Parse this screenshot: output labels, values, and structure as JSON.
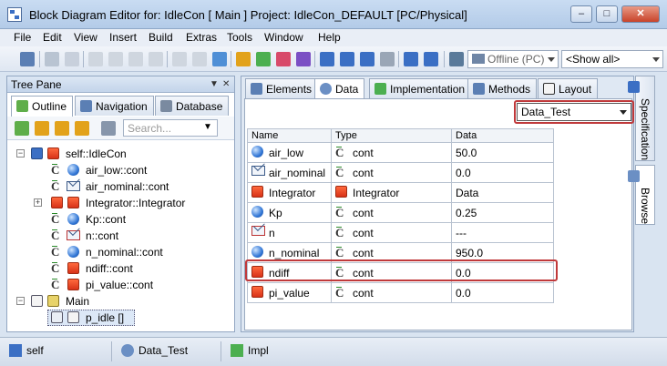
{
  "window": {
    "title": "Block Diagram Editor for: IdleCon [ Main ] Project: IdleCon_DEFAULT [PC/Physical]",
    "minimize_glyph": "–",
    "maximize_glyph": "□",
    "close_glyph": "✕"
  },
  "menu": [
    "File",
    "Edit",
    "View",
    "Insert",
    "Build",
    "Extras",
    "Tools",
    "Window",
    "Help"
  ],
  "toolbar": {
    "mode_value": "Offline (PC)",
    "show_value": "<Show all>"
  },
  "tree_pane": {
    "title": "Tree Pane",
    "tabs": [
      "Outline",
      "Navigation",
      "Database"
    ],
    "search_placeholder": "Search...",
    "nodes": [
      {
        "label": "self::IdleCon"
      },
      {
        "label": "air_low::cont"
      },
      {
        "label": "air_nominal::cont"
      },
      {
        "label": "Integrator::Integrator"
      },
      {
        "label": "Kp::cont"
      },
      {
        "label": "n::cont"
      },
      {
        "label": "n_nominal::cont"
      },
      {
        "label": "ndiff::cont"
      },
      {
        "label": "pi_value::cont"
      },
      {
        "label": "Main"
      },
      {
        "label": "p_idle []"
      }
    ]
  },
  "editor": {
    "tabs": [
      "Elements",
      "Data",
      "Implementation",
      "Methods",
      "Layout"
    ],
    "active_tab": "Data",
    "dataset_value": "Data_Test",
    "columns": [
      "Name",
      "Type",
      "Data"
    ],
    "rows": [
      {
        "name": "air_low",
        "type": "cont",
        "data": "50.0"
      },
      {
        "name": "air_nominal",
        "type": "cont",
        "data": "0.0"
      },
      {
        "name": "Integrator",
        "type": "Integrator",
        "data": "Data"
      },
      {
        "name": "Kp",
        "type": "cont",
        "data": "0.25"
      },
      {
        "name": "n",
        "type": "cont",
        "data": "---"
      },
      {
        "name": "n_nominal",
        "type": "cont",
        "data": "950.0"
      },
      {
        "name": "ndiff",
        "type": "cont",
        "data": "0.0"
      },
      {
        "name": "pi_value",
        "type": "cont",
        "data": "0.0"
      }
    ]
  },
  "side_tabs": [
    "Specification",
    "Browse"
  ],
  "status": {
    "item1": "self",
    "item2": "Data_Test",
    "item3": "Impl"
  },
  "colors": {
    "highlight": "#c0393b",
    "element_blue": "#3277d6",
    "element_red": "#d83218"
  }
}
